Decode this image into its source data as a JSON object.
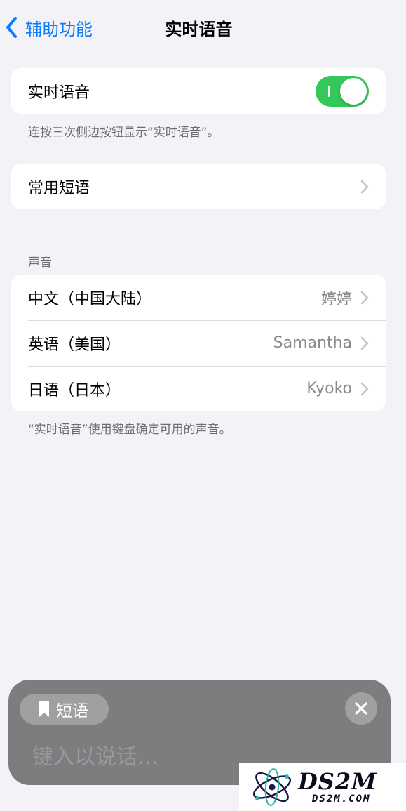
{
  "nav": {
    "back_label": "辅助功能",
    "title": "实时语音"
  },
  "live_speech": {
    "label": "实时语音",
    "toggle_on": true,
    "footnote": "连按三次侧边按钮显示“实时语音”。"
  },
  "phrases": {
    "label": "常用短语"
  },
  "voices": {
    "header": "声音",
    "items": [
      {
        "label": "中文（中国大陆）",
        "value": "婷婷"
      },
      {
        "label": "英语（美国）",
        "value": "Samantha"
      },
      {
        "label": "日语（日本）",
        "value": "Kyoko"
      }
    ],
    "footnote": "“实时语音”使用键盘确定可用的声音。"
  },
  "speech_panel": {
    "chip_label": "短语",
    "input_placeholder": "键入以说话…"
  },
  "watermark": {
    "brand": "DS2M",
    "url": "DS2M.COM"
  },
  "colors": {
    "accent": "#0a7aff",
    "toggle_on": "#34c759",
    "background": "#f2f2f7"
  }
}
